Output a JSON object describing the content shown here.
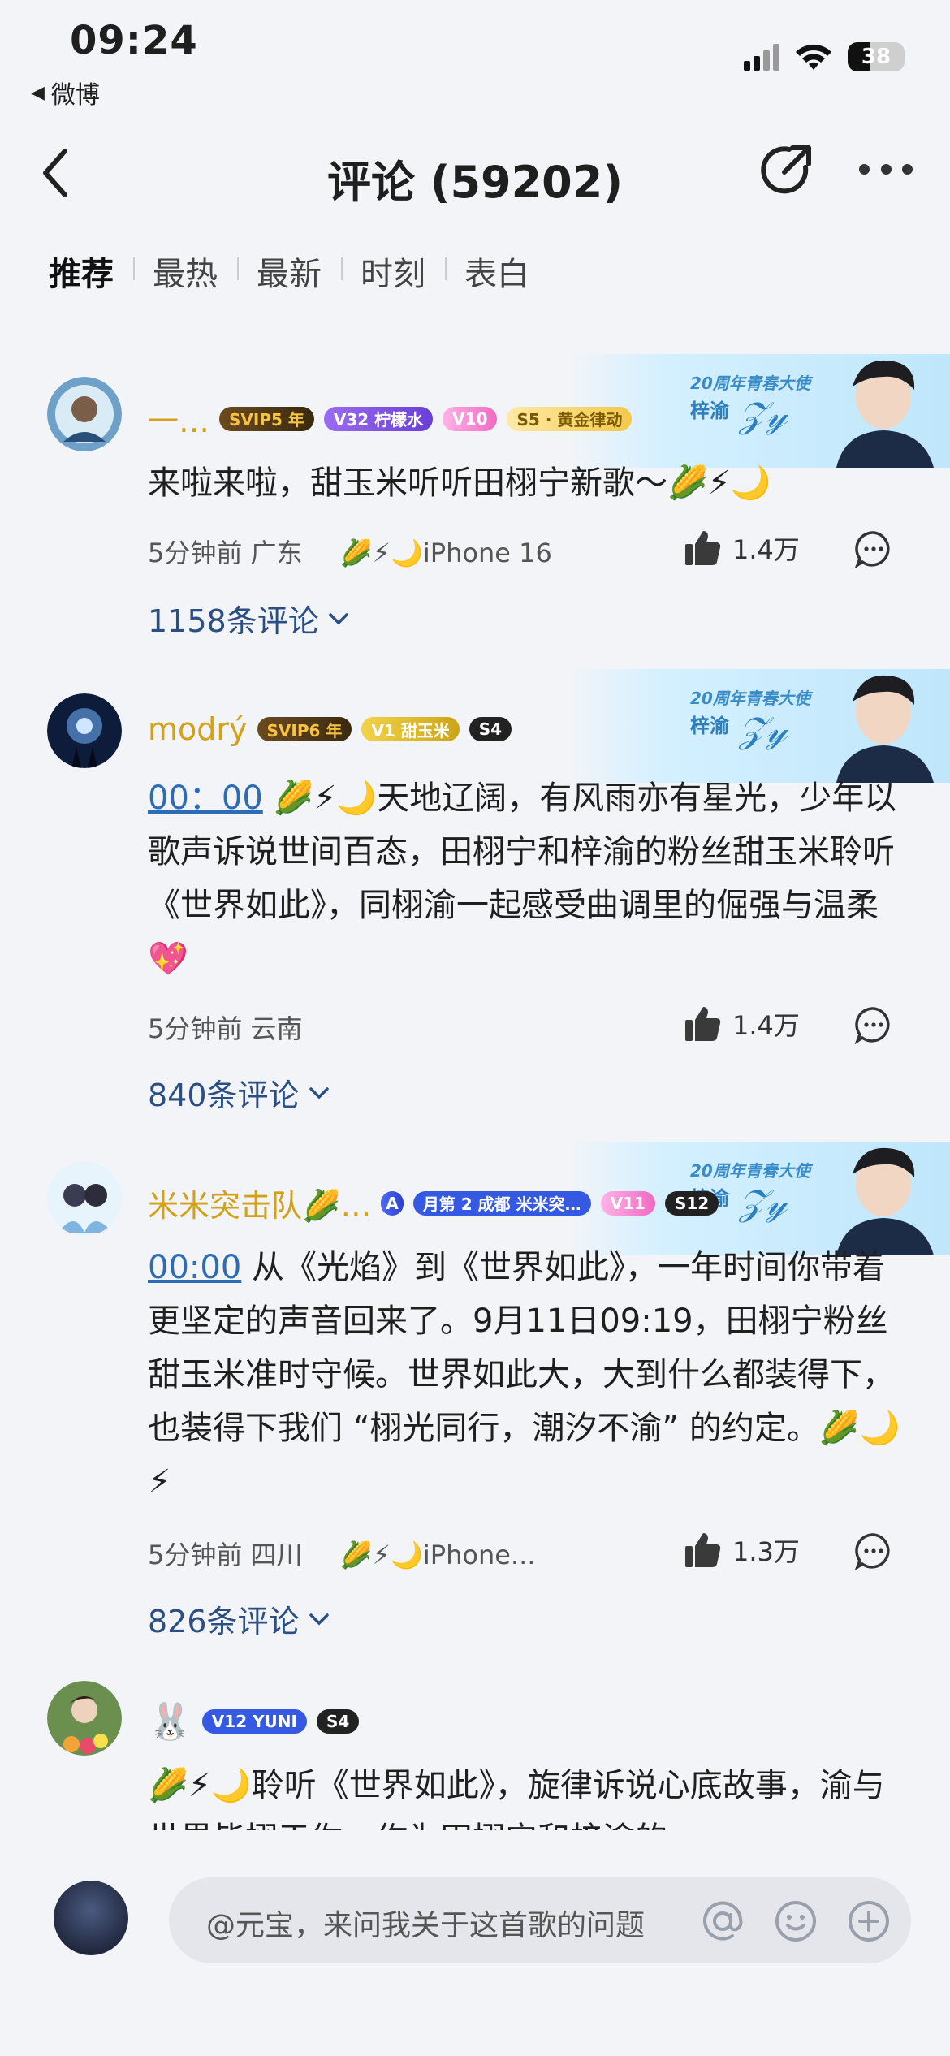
{
  "status_bar": {
    "time": "09:24",
    "back_app": "微博",
    "battery": "38"
  },
  "header": {
    "title": "评论 (59202)"
  },
  "tabs": [
    {
      "label": "推荐",
      "active": true
    },
    {
      "label": "最热"
    },
    {
      "label": "最新"
    },
    {
      "label": "时刻"
    },
    {
      "label": "表白"
    }
  ],
  "banner": {
    "title": "20周年青春大使",
    "name": "梓渝"
  },
  "comments": [
    {
      "username": "一…",
      "badges": [
        "SVIP5 年",
        "V32 柠檬水",
        "V10",
        "S5 · 黄金律动"
      ],
      "text": "来啦来啦，甜玉米听听田栩宁新歌～🌽⚡🌙",
      "time": "5分钟前",
      "location": "广东",
      "device": "🌽⚡🌙iPhone 16",
      "likes": "1.4万",
      "replies": "1158条评论"
    },
    {
      "username": "modrý",
      "badges": [
        "SVIP6 年",
        "V1 甜玉米",
        "S4"
      ],
      "timestamp_link": "00：00",
      "text": " 🌽⚡🌙天地辽阔，有风雨亦有星光，少年以歌声诉说世间百态，田栩宁和梓渝的粉丝甜玉米聆听《世界如此》，同栩渝一起感受曲调里的倔强与温柔💖",
      "time": "5分钟前",
      "location": "云南",
      "likes": "1.4万",
      "replies": "840条评论"
    },
    {
      "username": "米米突击队🌽…",
      "badges": [
        "月第 2 成都 米米突…",
        "V11",
        "S12"
      ],
      "timestamp_link": "00:00",
      "text": " 从《光焰》到《世界如此》，一年时间你带着更坚定的声音回来了。9月11日09:19，田栩宁粉丝甜玉米准时守候。世界如此大，大到什么都装得下，也装得下我们 “栩光同行，潮汐不渝” 的约定。🌽🌙⚡",
      "time": "5分钟前",
      "location": "四川",
      "device": "🌽⚡🌙iPhone...",
      "likes": "1.3万",
      "replies": "826条评论"
    },
    {
      "username": "🐰",
      "badges": [
        "V12 YUNI",
        "S4"
      ],
      "text": "🌽⚡🌙聆听《世界如此》，旋律诉说心底故事，渝与世界皆栩于你，作为田栩宁和梓渝的"
    }
  ],
  "bottom": {
    "placeholder": "@元宝，来问我关于这首歌的问题"
  }
}
